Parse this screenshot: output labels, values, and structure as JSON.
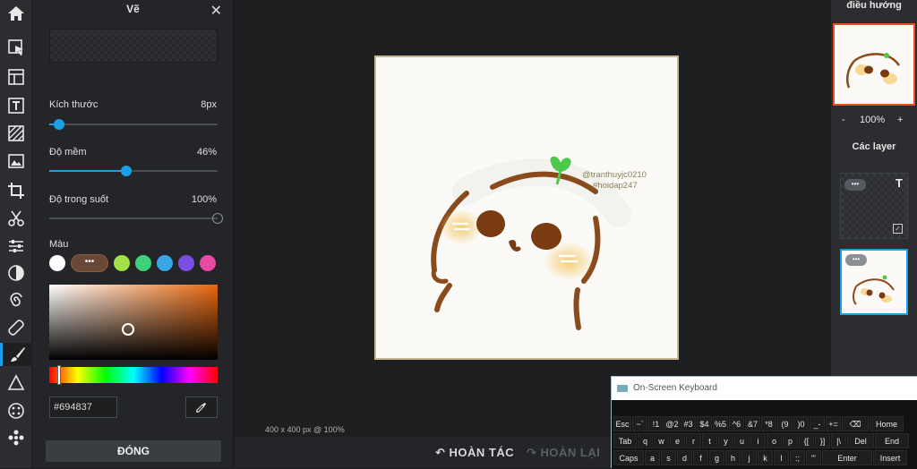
{
  "left_panel": {
    "title": "Vẽ",
    "size_label": "Kích thước",
    "size_value": "8px",
    "size_fraction": 0.06,
    "softness_label": "Độ mềm",
    "softness_value": "46%",
    "softness_fraction": 0.46,
    "opacity_label": "Độ trong suốt",
    "opacity_value": "100%",
    "opacity_fraction": 1.0,
    "color_label": "Màu",
    "swatches": [
      "#ffffff",
      "#694837",
      "#a3e048",
      "#3fd07a",
      "#3aa6e8",
      "#7a4ee0",
      "#e84aa6"
    ],
    "active_swatch_glyph": "•••",
    "hex_value": "#694837",
    "close_label": "ĐÓNG"
  },
  "toolbar": {
    "icons": [
      "home-icon",
      "select-icon",
      "layout-icon",
      "text-icon",
      "pattern-icon",
      "image-icon",
      "crop-icon",
      "cut-icon",
      "adjust-icon",
      "contrast-icon",
      "swirl-icon",
      "bandage-icon",
      "brush-icon",
      "shape-icon",
      "dots-icon",
      "effects-icon"
    ]
  },
  "canvas": {
    "watermark_user": "@tranthuyjc0210",
    "watermark_tag": "#hoidap247",
    "status": "400 x 400 px @ 100%"
  },
  "bottom": {
    "undo_label": "HOÀN TÁC",
    "redo_label": "HOÀN LẠI"
  },
  "right_panel": {
    "nav_title": "điều hướng",
    "zoom_minus": "-",
    "zoom_value": "100%",
    "zoom_plus": "+",
    "layers_title": "Các layer",
    "layer_menu": "•••",
    "text_layer_glyph": "T"
  },
  "osk": {
    "title": "On-Screen Keyboard",
    "row1": [
      "Esc",
      "~`",
      "!1",
      "@2",
      "#3",
      "$4",
      "%5",
      "^6",
      "&7",
      "*8",
      "(9",
      ")0",
      "_-",
      "+=",
      "⌫",
      "Home"
    ],
    "row2": [
      "Tab",
      "q",
      "w",
      "e",
      "r",
      "t",
      "y",
      "u",
      "i",
      "o",
      "p",
      "{[",
      "}]",
      "|\\",
      "Del",
      "End"
    ],
    "row3": [
      "Caps",
      "a",
      "s",
      "d",
      "f",
      "g",
      "h",
      "j",
      "k",
      "l",
      ":;",
      "\"'",
      "Enter",
      "Insert"
    ]
  }
}
